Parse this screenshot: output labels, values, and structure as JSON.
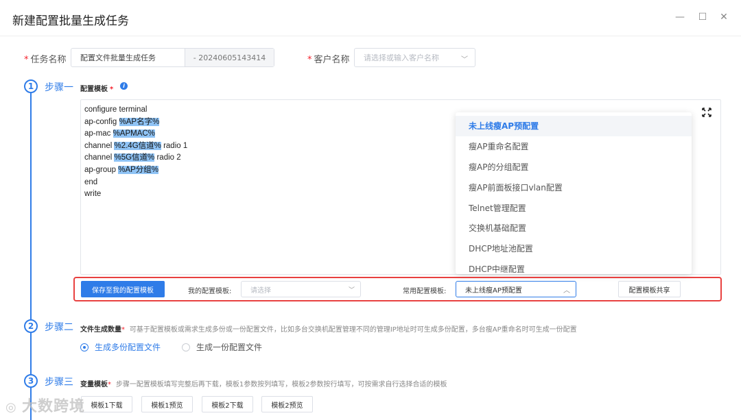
{
  "window": {
    "title": "新建配置批量生成任务",
    "controls": {
      "minimize": "—",
      "maximize": "☐",
      "close": "✕"
    }
  },
  "form": {
    "task_name_label": "任务名称",
    "task_name_value": "配置文件批量生成任务",
    "task_name_suffix": "- 20240605143414",
    "customer_label": "客户名称",
    "customer_placeholder": "请选择或输入客户名称"
  },
  "step1": {
    "number": "1",
    "title": "步骤一",
    "template_label": "配置模板",
    "code_lines": [
      {
        "text": "configure terminal",
        "var": "",
        "after": ""
      },
      {
        "text": "ap-config ",
        "var": "%AP名字%",
        "after": ""
      },
      {
        "text": "ap-mac ",
        "var": "%APMAC%",
        "after": ""
      },
      {
        "text": "channel ",
        "var": "%2.4G信道%",
        "after": " radio 1"
      },
      {
        "text": "channel ",
        "var": "%5G信道%",
        "after": " radio 2"
      },
      {
        "text": "ap-group ",
        "var": "%AP分组%",
        "after": ""
      },
      {
        "text": "end",
        "var": "",
        "after": ""
      },
      {
        "text": "write",
        "var": "",
        "after": ""
      }
    ],
    "dropdown_items": [
      "未上线瘦AP预配置",
      "瘦AP重命名配置",
      "瘦AP的分组配置",
      "瘦AP前面板接口vlan配置",
      "Telnet管理配置",
      "交换机基础配置",
      "DHCP地址池配置",
      "DHCP中继配置"
    ],
    "dropdown_selected_index": 0,
    "save_button": "保存至我的配置模板",
    "my_template_label": "我的配置模板:",
    "my_template_placeholder": "请选择",
    "common_template_label": "常用配置模板:",
    "common_template_value": "未上线瘦AP预配置",
    "share_button": "配置模板共享"
  },
  "step2": {
    "number": "2",
    "title": "步骤二",
    "label": "文件生成数量",
    "hint": "可基于配置模板或需求生成多份或一份配置文件，比如多台交换机配置管理不同的管理IP地址时可生成多份配置，多台瘦AP重命名时可生成一份配置",
    "option_multi": "生成多份配置文件",
    "option_single": "生成一份配置文件"
  },
  "step3": {
    "number": "3",
    "title": "步骤三",
    "label": "变量模板",
    "hint": "步骤一配置模板填写完整后再下载，模板1参数按列填写，模板2参数按行填写，可按需求自行选择合适的模板",
    "buttons": [
      "模板1下载",
      "模板1预览",
      "模板2下载",
      "模板2预览"
    ]
  },
  "watermark": "大数跨境",
  "colors": {
    "primary": "#2f7ce8",
    "highlight_border": "#e8403f",
    "required": "#f5222d"
  }
}
